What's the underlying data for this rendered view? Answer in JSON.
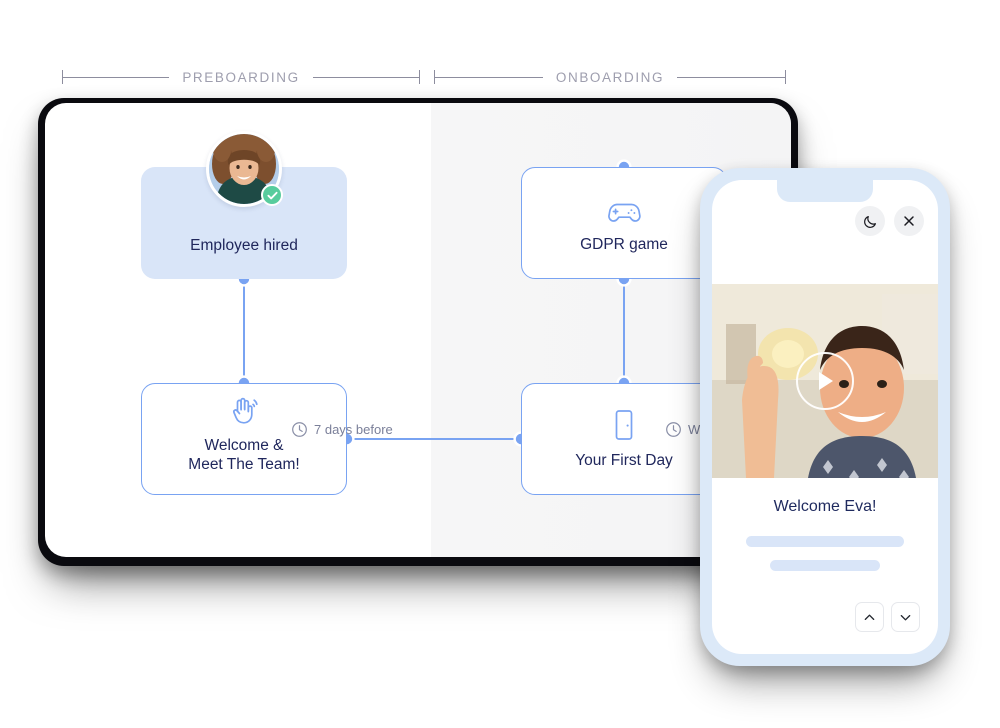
{
  "sections": [
    {
      "label": "PREBOARDING"
    },
    {
      "label": "ONBOARDING"
    }
  ],
  "flow": {
    "cards": [
      {
        "id": "employee-hired",
        "title": "Employee hired",
        "icon": "avatar-photo",
        "style": "filled",
        "badge": "check-badge-icon"
      },
      {
        "id": "welcome-meet-team",
        "title_line1": "Welcome &",
        "title_line2": "Meet The Team!",
        "icon": "waving-hand-icon",
        "style": "outline"
      },
      {
        "id": "gdpr-game",
        "title": "GDPR game",
        "icon": "gamepad-icon",
        "style": "outline"
      },
      {
        "id": "your-first-day",
        "title": "Your First Day",
        "icon": "door-icon",
        "style": "outline"
      }
    ],
    "delays": [
      {
        "id": "delay-left",
        "icon": "clock-icon",
        "label": "7 days before"
      },
      {
        "id": "delay-right",
        "icon": "clock-icon",
        "label": "Wait 2 days"
      }
    ]
  },
  "phone": {
    "topbar": [
      {
        "id": "dark-mode",
        "icon": "moon-icon"
      },
      {
        "id": "close",
        "icon": "close-icon"
      }
    ],
    "video": {
      "play_icon": "play-icon",
      "alt": "man waving hello"
    },
    "title": "Welcome Eva!",
    "nav": [
      {
        "id": "prev",
        "icon": "chevron-up-icon"
      },
      {
        "id": "next",
        "icon": "chevron-down-icon"
      }
    ]
  },
  "colors": {
    "accent_blue": "#79a3f2",
    "card_fill": "#d9e5f8",
    "text_navy": "#20275c",
    "muted_gray": "#7a7f99",
    "badge_green": "#57cc9d",
    "phone_frame": "#dce9f8"
  }
}
